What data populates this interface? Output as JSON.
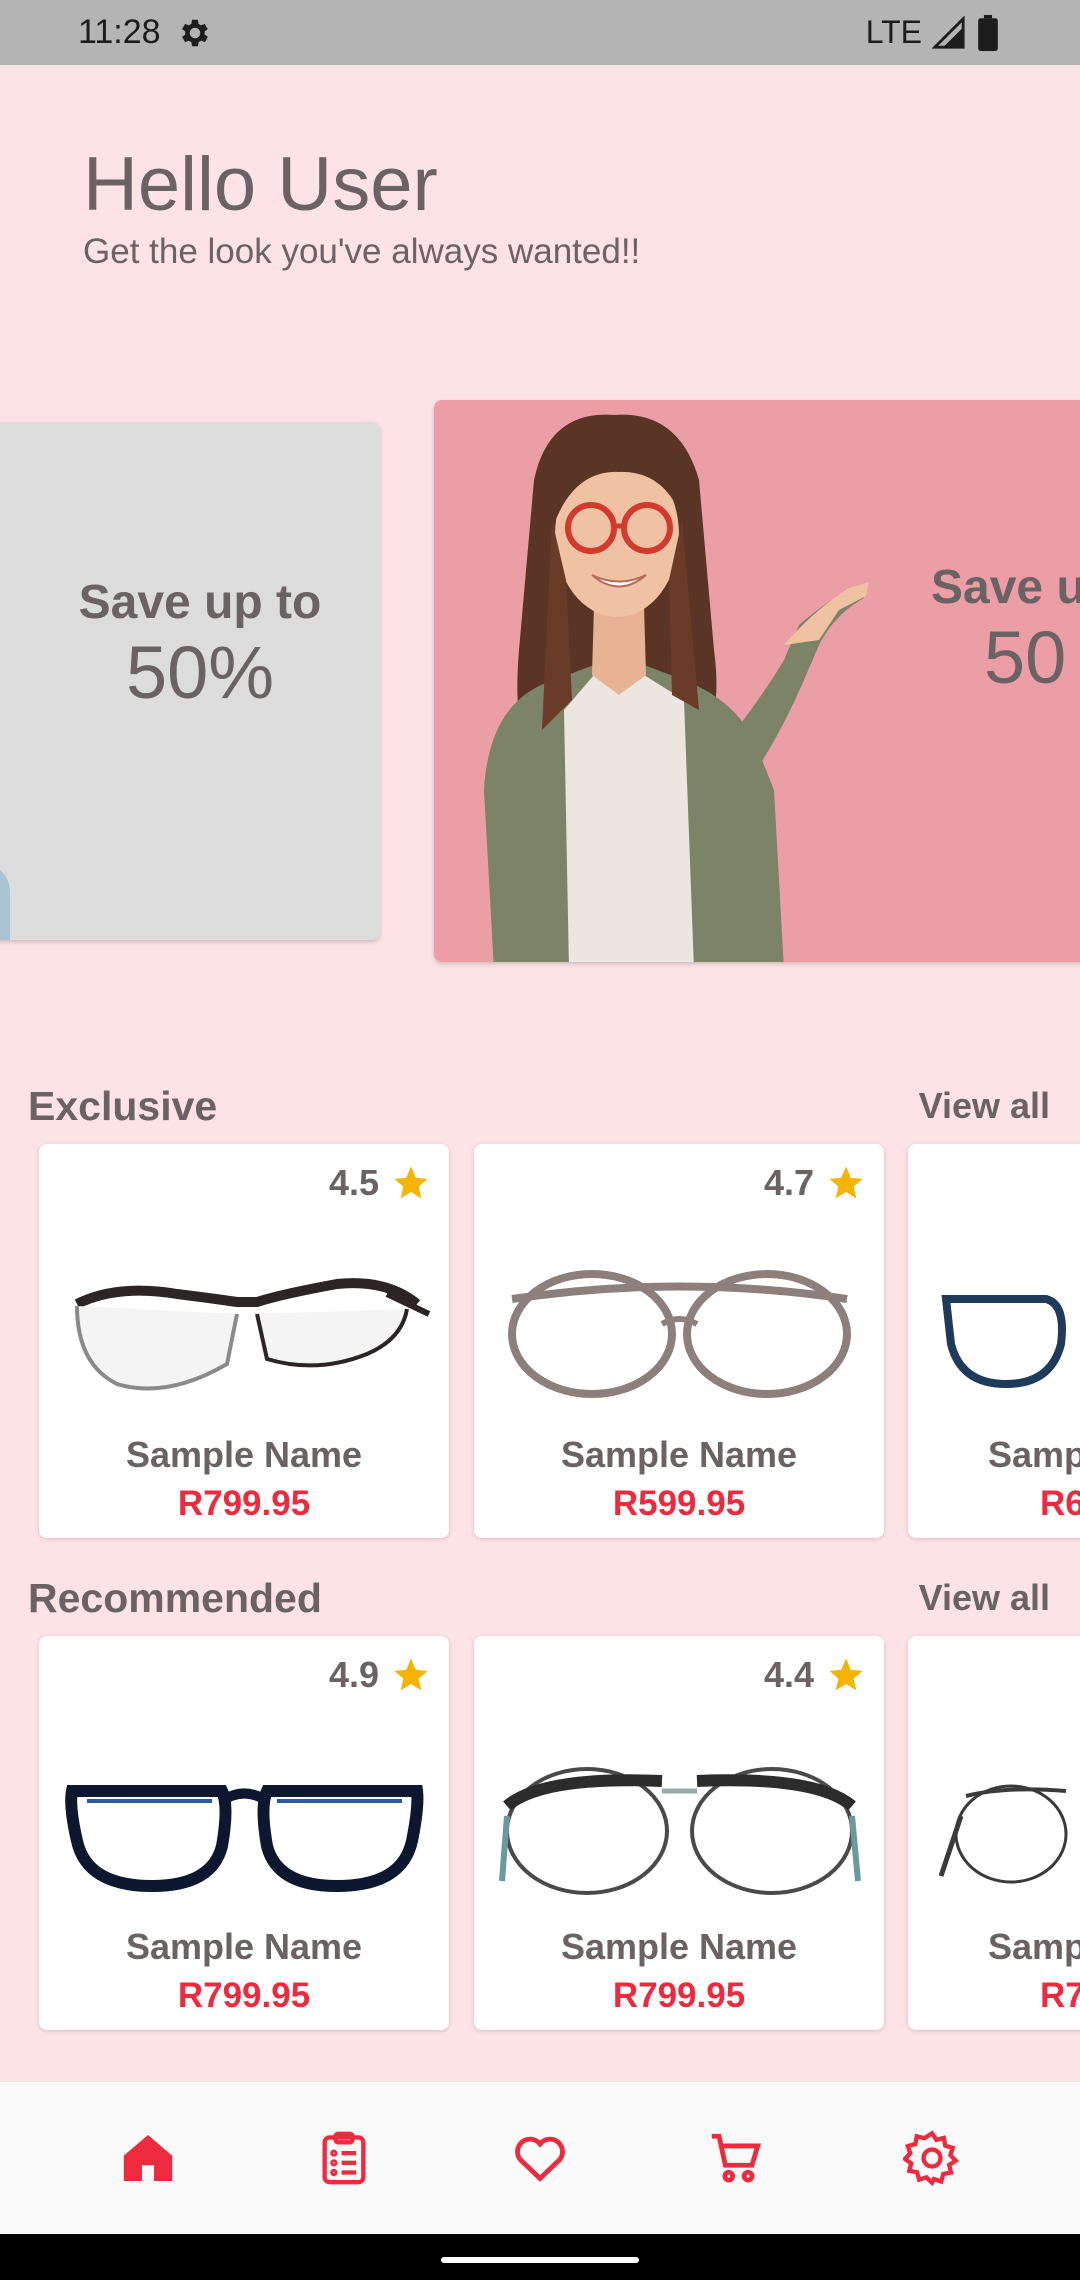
{
  "status_bar": {
    "time": "11:28",
    "network": "LTE"
  },
  "greeting": {
    "title": "Hello User",
    "subtitle": "Get the look you've always wanted!!"
  },
  "banners": [
    {
      "line1": "Save up to",
      "line2": "50%",
      "background": "#dcdcdc"
    },
    {
      "line1": "Save u",
      "line2": "50",
      "background": "#eb9ea6"
    }
  ],
  "sections": {
    "exclusive": {
      "title": "Exclusive",
      "view_all": "View all",
      "products": [
        {
          "rating": "4.5",
          "name": "Sample Name",
          "price": "R799.95",
          "frame_color": "#2b2525"
        },
        {
          "rating": "4.7",
          "name": "Sample Name",
          "price": "R599.95",
          "frame_color": "#8c7f7c"
        },
        {
          "rating": "",
          "name": "Samp",
          "price": "R6",
          "frame_color": "#1f3a5a"
        }
      ]
    },
    "recommended": {
      "title": "Recommended",
      "view_all": "View all",
      "products": [
        {
          "rating": "4.9",
          "name": "Sample Name",
          "price": "R799.95",
          "frame_color": "#0d1730"
        },
        {
          "rating": "4.4",
          "name": "Sample Name",
          "price": "R799.95",
          "frame_color": "#2c2c2c"
        },
        {
          "rating": "",
          "name": "Samp",
          "price": "R7",
          "frame_color": "#3a3a3a"
        }
      ]
    }
  },
  "bottom_nav": {
    "items": [
      "home-icon",
      "orders-icon",
      "favorites-icon",
      "cart-icon",
      "settings-icon"
    ],
    "active": "home-icon",
    "accent": "#ee2a3f"
  },
  "colors": {
    "background": "#fde2e6",
    "text": "#6b6363",
    "price": "#ee2a3f",
    "star": "#f5b400"
  }
}
